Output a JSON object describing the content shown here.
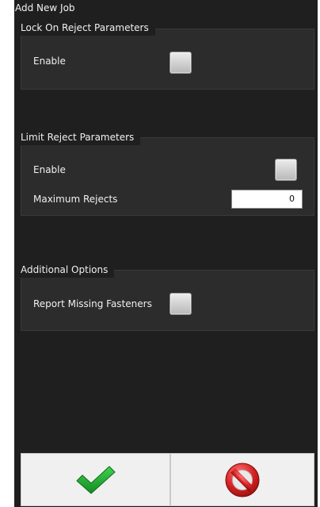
{
  "window": {
    "title": "Add New Job"
  },
  "lock_on_reject": {
    "title": "Lock On Reject Parameters",
    "enable_label": "Enable",
    "enabled": false
  },
  "limit_reject": {
    "title": "Limit Reject Parameters",
    "enable_label": "Enable",
    "enabled": false,
    "max_rejects_label": "Maximum Rejects",
    "max_rejects_value": "0"
  },
  "additional_options": {
    "title": "Additional Options",
    "report_missing_label": "Report Missing Fasteners",
    "report_missing_enabled": false
  },
  "actions": {
    "confirm_icon": "checkmark-icon",
    "cancel_icon": "no-entry-icon",
    "colors": {
      "confirm": "#1f9a2e",
      "cancel": "#c81e1e"
    }
  }
}
